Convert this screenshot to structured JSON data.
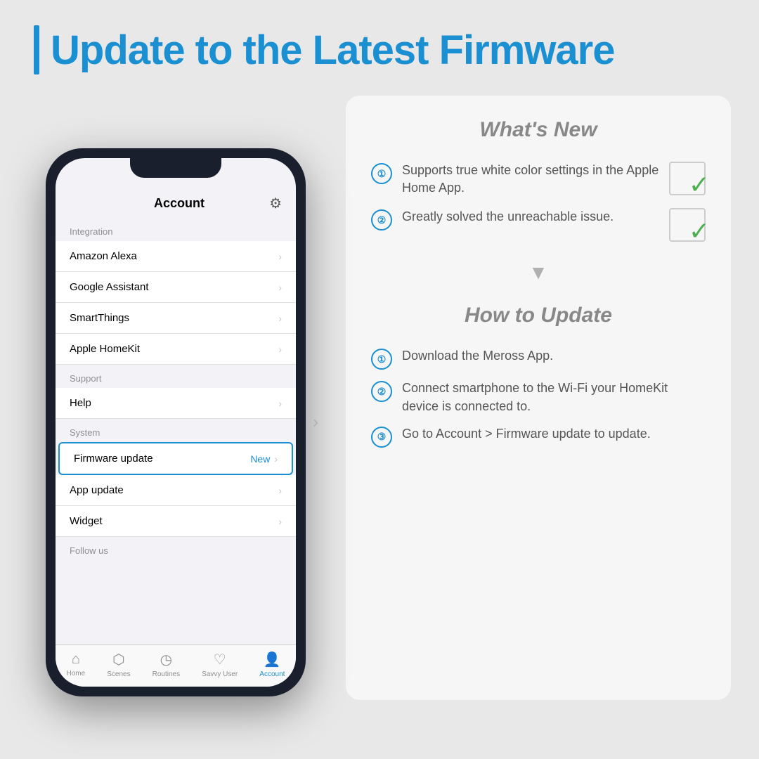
{
  "header": {
    "bar_decoration": "|",
    "title": "Update to the Latest Firmware"
  },
  "phone": {
    "screen_title": "Account",
    "sections": [
      {
        "label": "Integration",
        "items": [
          {
            "text": "Amazon Alexa",
            "new": "",
            "chevron": "›"
          },
          {
            "text": "Google Assistant",
            "new": "",
            "chevron": "›"
          },
          {
            "text": "SmartThings",
            "new": "",
            "chevron": "›"
          },
          {
            "text": "Apple HomeKit",
            "new": "",
            "chevron": "›"
          }
        ]
      },
      {
        "label": "Support",
        "items": [
          {
            "text": "Help",
            "new": "",
            "chevron": "›"
          }
        ]
      },
      {
        "label": "System",
        "items": [
          {
            "text": "Firmware update",
            "new": "New",
            "chevron": "›",
            "highlighted": true
          },
          {
            "text": "App update",
            "new": "",
            "chevron": "›"
          },
          {
            "text": "Widget",
            "new": "",
            "chevron": "›"
          }
        ]
      },
      {
        "label": "Follow us",
        "items": []
      }
    ],
    "nav": [
      {
        "icon": "🏠",
        "label": "Home",
        "active": false
      },
      {
        "icon": "🎬",
        "label": "Scenes",
        "active": false
      },
      {
        "icon": "🕐",
        "label": "Routines",
        "active": false
      },
      {
        "icon": "♡",
        "label": "Savvy User",
        "active": false
      },
      {
        "icon": "👤",
        "label": "Account",
        "active": true
      }
    ]
  },
  "right_panel": {
    "whats_new_title": "What's New",
    "features": [
      {
        "num": "①",
        "text": "Supports true white color settings in the Apple Home App."
      },
      {
        "num": "②",
        "text": "Greatly solved the unreachable issue."
      }
    ],
    "how_to_title": "How to Update",
    "steps": [
      {
        "num": "①",
        "text": "Download the Meross App."
      },
      {
        "num": "②",
        "text": "Connect smartphone to the Wi-Fi your HomeKit device is connected to."
      },
      {
        "num": "③",
        "text": "Go to Account > Firmware update to update."
      }
    ]
  }
}
